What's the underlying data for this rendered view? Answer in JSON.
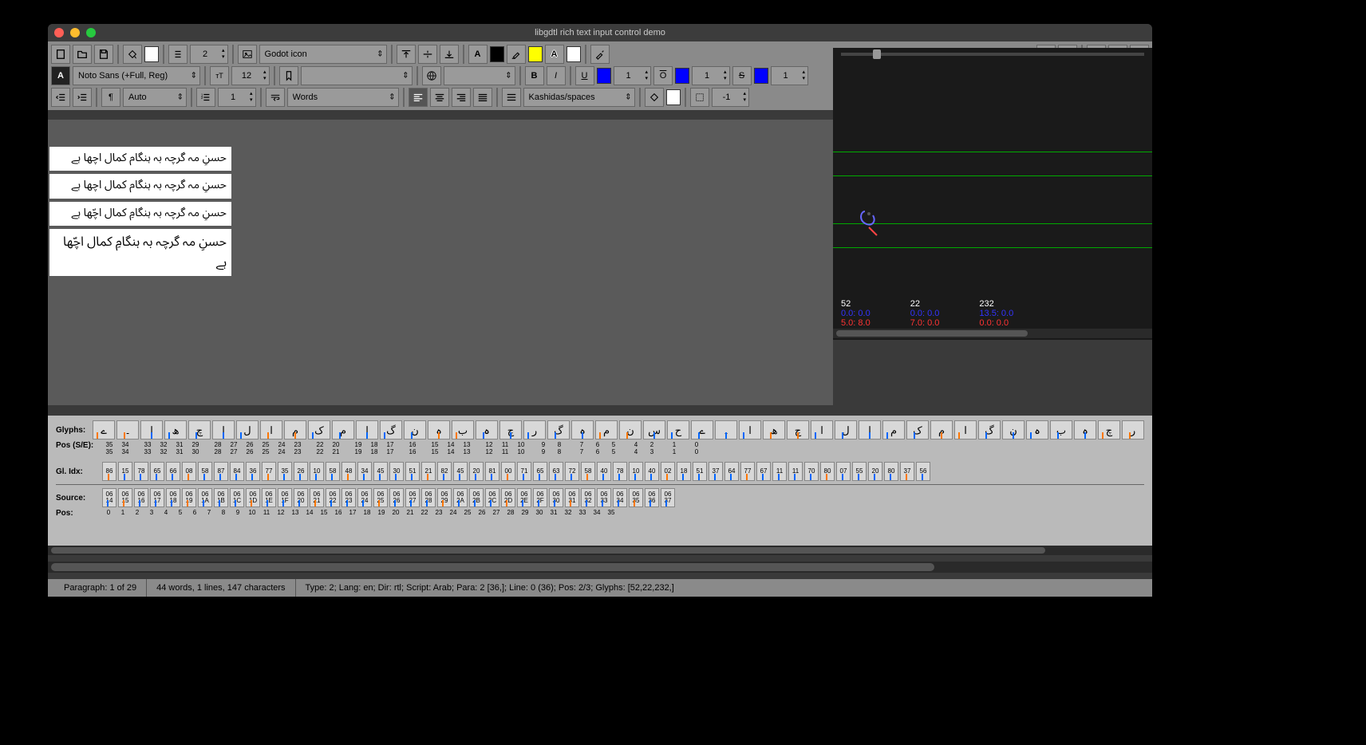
{
  "window": {
    "title": "libgdtl rich text input control demo"
  },
  "toolbar": {
    "indent_value": "2",
    "image_select": "Godot icon",
    "font_select": "Noto Sans (+Full, Reg)",
    "font_size": "12",
    "underline_val": "1",
    "overline_val": "1",
    "strike_val": "1",
    "para_align": "Auto",
    "list_val": "1",
    "wrap_mode": "Words",
    "justify_mode": "Kashidas/spaces",
    "margin_val": "-1"
  },
  "editor": {
    "lines": [
      "حسنِ مہ گرچہ بہ ہنگام کمال اچھا ہے",
      "حسنِ مہ گرچہ بہ ہنگام کمال اچھا ہے",
      "حسنِ مہ گرچہ بہ ہنگامِ کمال اچّھا ہے",
      "حسنِ مہ گرچہ بہ ہنگامِ کمال اچّھا ہے"
    ]
  },
  "metrics": {
    "col1": {
      "a": "52",
      "b": "0.0: 0.0",
      "c": "5.0: 8.0"
    },
    "col2": {
      "a": "22",
      "b": "0.0: 0.0",
      "c": "7.0: 0.0"
    },
    "col3": {
      "a": "232",
      "b": "13.5: 0.0",
      "c": "0.0: 0.0"
    }
  },
  "inspector": {
    "glyphs_label": "Glyphs:",
    "pos_label": "Pos (S/E):",
    "glidx_label": "Gl. Idx:",
    "source_label": "Source:",
    "srcpos_label": "Pos:",
    "pos_pairs": [
      [
        "35",
        "35"
      ],
      [
        "34",
        "34"
      ],
      [
        "",
        "|"
      ],
      [
        "33",
        "33"
      ],
      [
        "32",
        "32"
      ],
      [
        "31",
        "31"
      ],
      [
        "29",
        "30"
      ],
      [
        "",
        "|"
      ],
      [
        "28",
        "28"
      ],
      [
        "27",
        "27"
      ],
      [
        "26",
        "26"
      ],
      [
        "25",
        "25"
      ],
      [
        "24",
        "24"
      ],
      [
        "23",
        "23"
      ],
      [
        "",
        "|"
      ],
      [
        "22",
        "22"
      ],
      [
        "20",
        "21"
      ],
      [
        "",
        "|"
      ],
      [
        "19",
        "19"
      ],
      [
        "18",
        "18"
      ],
      [
        "17",
        "17"
      ],
      [
        "",
        "|"
      ],
      [
        "16",
        "16"
      ],
      [
        "",
        "|"
      ],
      [
        "15",
        "15"
      ],
      [
        "14",
        "14"
      ],
      [
        "13",
        "13"
      ],
      [
        "",
        "|"
      ],
      [
        "12",
        "12"
      ],
      [
        "11",
        "11"
      ],
      [
        "10",
        "10"
      ],
      [
        "",
        "|"
      ],
      [
        "9",
        "9"
      ],
      [
        "8",
        "8"
      ],
      [
        "",
        "|"
      ],
      [
        "7",
        "7"
      ],
      [
        "6",
        "6"
      ],
      [
        "5",
        "5"
      ],
      [
        "",
        "|"
      ],
      [
        "4",
        "4"
      ],
      [
        "2",
        "3"
      ],
      [
        "",
        "|"
      ],
      [
        "1",
        "1"
      ],
      [
        "",
        "|"
      ],
      [
        "0",
        "0"
      ]
    ],
    "source_pos": [
      "0",
      "1",
      "2",
      "3",
      "4",
      "5",
      "6",
      "7",
      "8",
      "9",
      "10",
      "11",
      "12",
      "13",
      "14",
      "15",
      "16",
      "17",
      "18",
      "19",
      "20",
      "21",
      "22",
      "23",
      "24",
      "25",
      "26",
      "27",
      "28",
      "29",
      "30",
      "31",
      "32",
      "33",
      "34",
      "35"
    ]
  },
  "status": {
    "paragraph": "Paragraph: 1 of 29",
    "counts": "44 words, 1 lines, 147 characters",
    "details": "Type: 2; Lang: en; Dir: rtl; Script: Arab; Para: 2 [36,]; Line: 0 (36); Pos: 2/3; Glyphs: [52,22,232,]"
  }
}
